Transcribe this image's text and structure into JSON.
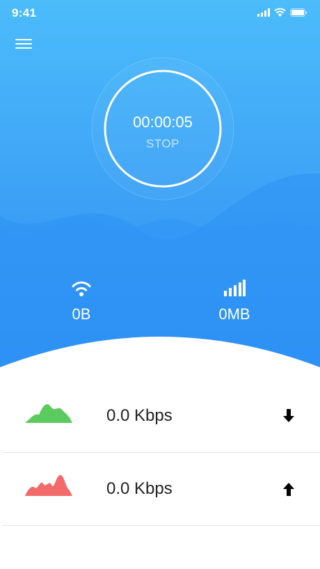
{
  "status_bar": {
    "time": "9:41",
    "icons": [
      "signal-icon",
      "wifi-icon",
      "battery-icon"
    ]
  },
  "header": {
    "menu_icon": "hamburger-menu-icon"
  },
  "timer": {
    "elapsed": "00:00:05",
    "stop_label": "STOP"
  },
  "stats": {
    "wifi": {
      "icon": "wifi-icon",
      "value": "0B"
    },
    "cellular": {
      "icon": "cellular-signal-icon",
      "value": "0MB"
    }
  },
  "rows": {
    "download": {
      "icon": "download-arrow-icon",
      "speed": "0.0 Kbps",
      "graph_color": "#5ccb5f"
    },
    "upload": {
      "icon": "upload-arrow-icon",
      "speed": "0.0 Kbps",
      "graph_color": "#f36a6a"
    }
  },
  "colors": {
    "hero_top": "#47b9fb",
    "hero_bottom": "#2f8cf2",
    "background": "#ffffff"
  }
}
